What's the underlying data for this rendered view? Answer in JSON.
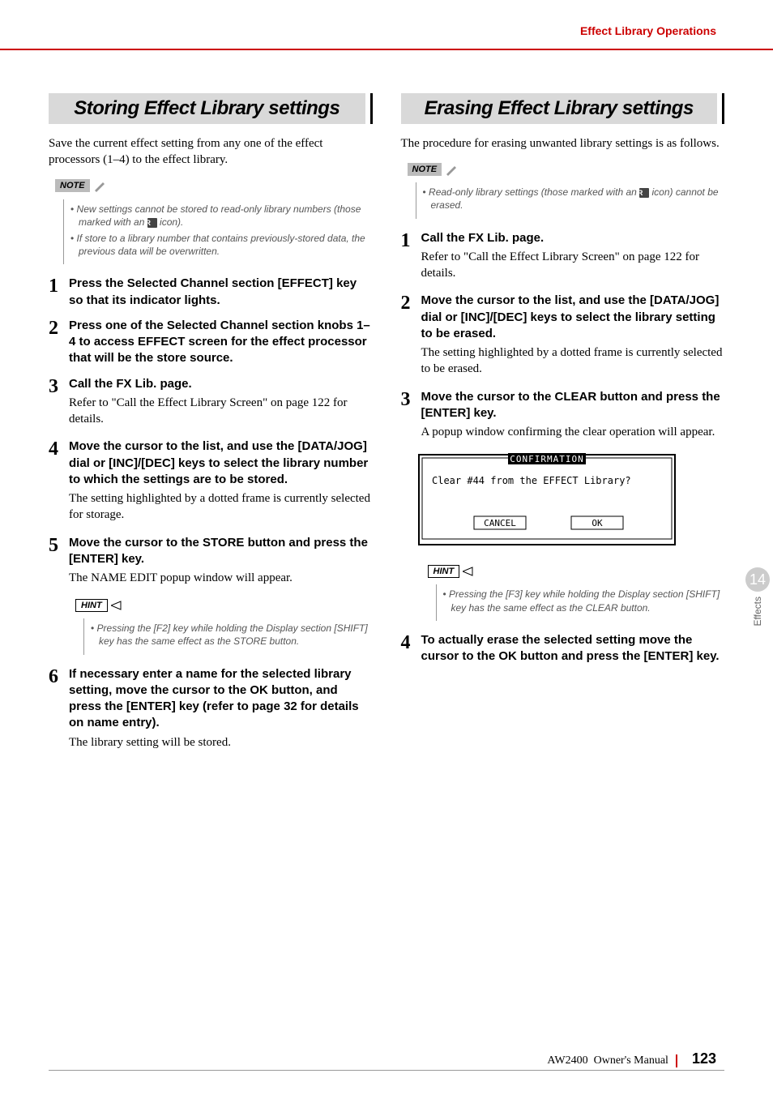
{
  "runningHead": "Effect Library Operations",
  "sideTab": {
    "num": "14",
    "label": "Effects"
  },
  "footer": {
    "product": "AW2400",
    "doc": "Owner's Manual",
    "page": "123"
  },
  "left": {
    "title": "Storing Effect Library settings",
    "intro": "Save the current effect setting from any one of the effect processors (1–4) to the effect library.",
    "noteLabel": "NOTE",
    "notes": [
      {
        "pre": "New settings cannot be stored to read-only library numbers (those marked with an ",
        "icon": "R",
        "post": " icon)."
      },
      {
        "pre": "If store to a library number that contains previously-stored data, the previous data will be overwritten.",
        "icon": "",
        "post": ""
      }
    ],
    "steps": [
      {
        "n": "1",
        "head": "Press the Selected Channel section [EFFECT] key so that its indicator lights.",
        "text": ""
      },
      {
        "n": "2",
        "head": "Press one of the Selected Channel section knobs 1–4 to access EFFECT screen for the effect processor that will be the store source.",
        "text": ""
      },
      {
        "n": "3",
        "head": "Call the FX Lib. page.",
        "text": "Refer to \"Call the Effect Library Screen\" on page 122 for details."
      },
      {
        "n": "4",
        "head": "Move the cursor to the list, and use the [DATA/JOG] dial or [INC]/[DEC] keys to select the library number to which the settings are to be stored.",
        "text": "The setting highlighted by a dotted frame is currently selected for storage."
      },
      {
        "n": "5",
        "head": "Move the cursor to the STORE button and press the [ENTER] key.",
        "text": "The NAME EDIT popup window will appear."
      }
    ],
    "hintLabel": "HINT",
    "hints": [
      "Pressing the [F2] key while holding the Display section [SHIFT] key has the same effect as the STORE button."
    ],
    "step6": {
      "n": "6",
      "head": "If necessary enter a name for the selected library setting, move the cursor to the OK button, and press the [ENTER] key (refer to page 32 for details on name entry).",
      "text": "The library setting will be stored."
    }
  },
  "right": {
    "title": "Erasing Effect Library settings",
    "intro": "The procedure for erasing unwanted library settings is as follows.",
    "noteLabel": "NOTE",
    "notes": [
      {
        "pre": "Read-only library settings (those marked with an ",
        "icon": "R",
        "post": " icon) cannot be erased."
      }
    ],
    "steps": [
      {
        "n": "1",
        "head": "Call the FX Lib. page.",
        "text": "Refer to \"Call the Effect Library Screen\" on page 122 for details."
      },
      {
        "n": "2",
        "head": "Move the cursor to the list, and use the [DATA/JOG] dial or [INC]/[DEC] keys to select the library setting to be erased.",
        "text": "The setting highlighted by a dotted frame is currently selected to be erased."
      },
      {
        "n": "3",
        "head": "Move the cursor to the CLEAR button and press the [ENTER] key.",
        "text": "A popup window confirming the clear operation will appear."
      }
    ],
    "dialog": {
      "title": "CONFIRMATION",
      "message": "Clear #44 from the EFFECT Library?",
      "cancel": "CANCEL",
      "ok": "OK"
    },
    "hintLabel": "HINT",
    "hints": [
      "Pressing the [F3] key while holding the Display section [SHIFT] key has the same effect as the CLEAR button."
    ],
    "step4": {
      "n": "4",
      "head": "To actually erase the selected setting move the cursor to the OK button and press the [ENTER] key.",
      "text": ""
    }
  }
}
